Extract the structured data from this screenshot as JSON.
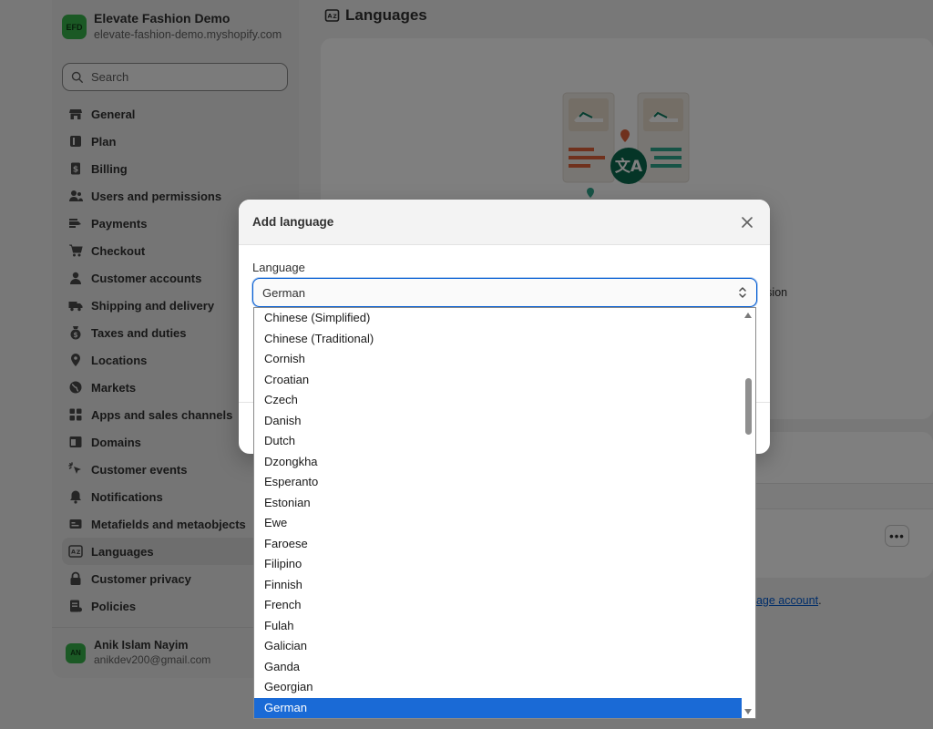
{
  "store": {
    "badge": "EFD",
    "name": "Elevate Fashion Demo",
    "url": "elevate-fashion-demo.myshopify.com"
  },
  "search": {
    "placeholder": "Search"
  },
  "nav": [
    {
      "label": "General",
      "icon": "store-icon"
    },
    {
      "label": "Plan",
      "icon": "plan-icon"
    },
    {
      "label": "Billing",
      "icon": "billing-icon"
    },
    {
      "label": "Users and permissions",
      "icon": "users-icon"
    },
    {
      "label": "Payments",
      "icon": "payments-icon"
    },
    {
      "label": "Checkout",
      "icon": "cart-icon"
    },
    {
      "label": "Customer accounts",
      "icon": "person-icon"
    },
    {
      "label": "Shipping and delivery",
      "icon": "truck-icon"
    },
    {
      "label": "Taxes and duties",
      "icon": "tax-icon"
    },
    {
      "label": "Locations",
      "icon": "location-icon"
    },
    {
      "label": "Markets",
      "icon": "globe-icon"
    },
    {
      "label": "Apps and sales channels",
      "icon": "apps-icon"
    },
    {
      "label": "Domains",
      "icon": "domains-icon"
    },
    {
      "label": "Customer events",
      "icon": "cursor-icon"
    },
    {
      "label": "Notifications",
      "icon": "bell-icon"
    },
    {
      "label": "Metafields and metaobjects",
      "icon": "metafields-icon"
    },
    {
      "label": "Languages",
      "icon": "language-icon",
      "active": true
    },
    {
      "label": "Customer privacy",
      "icon": "lock-icon"
    },
    {
      "label": "Policies",
      "icon": "policies-icon"
    }
  ],
  "user": {
    "initials": "AN",
    "name": "Anik Islam Nayim",
    "email": "anikdev200@gmail.com"
  },
  "page": {
    "title": "Languages",
    "desc_tail": "rsion",
    "manage_link": "nage account",
    "manage_suffix": ".",
    "more_label": "•••"
  },
  "modal": {
    "title": "Add language",
    "field_label": "Language",
    "selected_value": "German",
    "options": [
      "Chinese (Simplified)",
      "Chinese (Traditional)",
      "Cornish",
      "Croatian",
      "Czech",
      "Danish",
      "Dutch",
      "Dzongkha",
      "Esperanto",
      "Estonian",
      "Ewe",
      "Faroese",
      "Filipino",
      "Finnish",
      "French",
      "Fulah",
      "Galician",
      "Ganda",
      "Georgian",
      "German"
    ]
  },
  "colors": {
    "accent": "#005bd3",
    "brand_green": "#36b24a",
    "selected_option": "#1a6ad6",
    "illustration_teal": "#0a7a5f",
    "illustration_orange": "#e0623a"
  }
}
